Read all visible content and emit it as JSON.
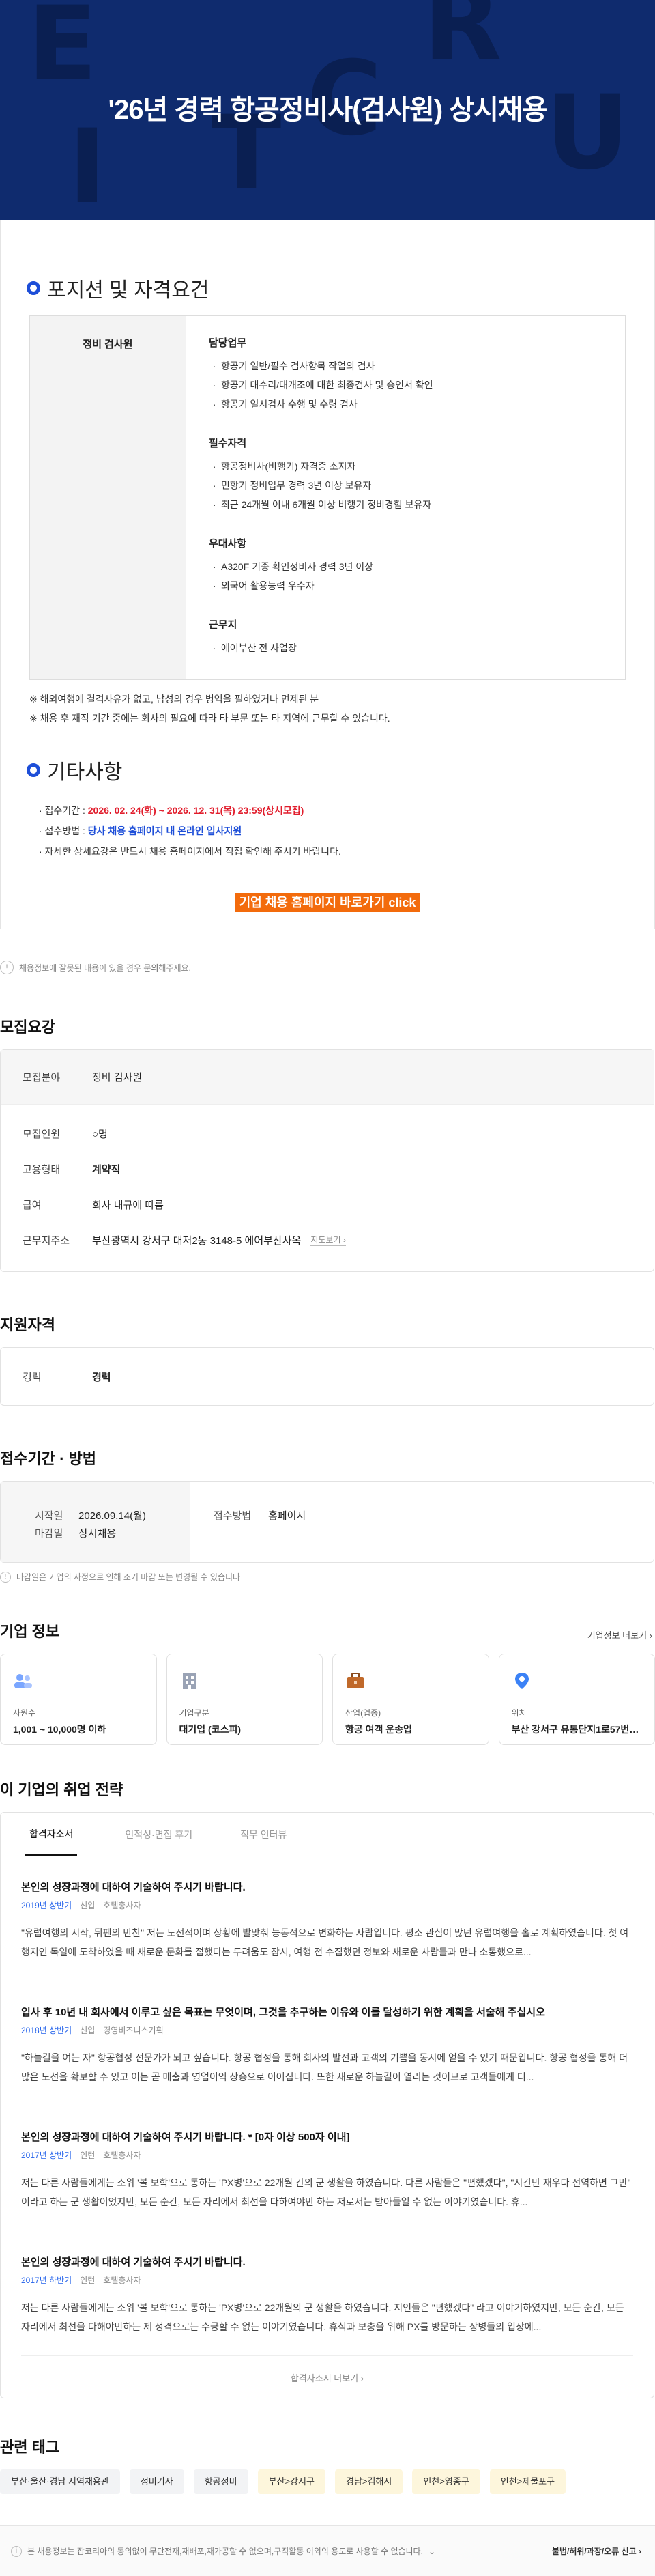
{
  "banner": {
    "title": "'26년 경력 항공정비사(검사원) 상시채용",
    "deco": [
      "E",
      "C",
      "R",
      "U",
      "I",
      "T"
    ]
  },
  "positions": {
    "heading": "포지션 및 자격요건",
    "role": "정비 검사원",
    "groups": [
      {
        "title": "담당업무",
        "items": [
          "항공기 일반/필수 검사항목 작업의 검사",
          "항공기 대수리/대개조에 대한 최종검사 및 승인서 확인",
          "항공기 일시검사 수행 및 수령 검사"
        ]
      },
      {
        "title": "필수자격",
        "items": [
          "항공정비사(비행기) 자격증 소지자",
          "민항기 정비업무 경력 3년 이상 보유자",
          "최근 24개월 이내 6개월 이상 비행기 정비경험 보유자"
        ]
      },
      {
        "title": "우대사항",
        "items": [
          "A320F 기종 확인정비사 경력 3년 이상",
          "외국어 활용능력 우수자"
        ]
      },
      {
        "title": "근무지",
        "items": [
          "에어부산 전 사업장"
        ]
      }
    ],
    "notes": [
      "※ 해외여행에 결격사유가 없고, 남성의 경우 병역을 필하였거나 면제된 분",
      "※ 채용 후 재직 기간 중에는 회사의 필요에 따라 타 부문 또는 타 지역에 근무할 수 있습니다."
    ]
  },
  "misc": {
    "heading": "기타사항",
    "period_label": "· 접수기간 : ",
    "period_value": "2026. 02. 24(화) ~ 2026. 12. 31(목) 23:59(상시모집)",
    "method_label": "· 접수방법 : ",
    "method_value": "당사 채용 홈페이지 내 온라인 입사지원",
    "detail": "· 자세한 상세요강은 반드시 채용 홈페이지에서 직접 확인해 주시기 바랍니다.",
    "button": "기업 채용 홈페이지 바로가기 click"
  },
  "report": {
    "icon": "!",
    "text_before": "채용정보에 잘못된 내용이 있을 경우 ",
    "link": "문의",
    "text_after": "해주세요."
  },
  "requirements": {
    "title": "모집요강",
    "rows": [
      {
        "k": "모집분야",
        "v": "정비 검사원"
      },
      {
        "k": "모집인원",
        "v": "○명"
      },
      {
        "k": "고용형태",
        "v": "계약직"
      },
      {
        "k": "급여",
        "v": "회사 내규에 따름"
      },
      {
        "k": "근무지주소",
        "v": "부산광역시 강서구 대저2동 3148-5 에어부산사옥"
      }
    ],
    "map": "지도보기 ›"
  },
  "qualification": {
    "title": "지원자격",
    "label": "경력",
    "value": "경력"
  },
  "apply": {
    "title": "접수기간 · 방법",
    "start_label": "시작일",
    "start_value": "2026.09.14(월)",
    "end_label": "마감일",
    "end_value": "상시채용",
    "method_label": "접수방법",
    "method_value": "홈페이지",
    "tip": "마감일은 기업의 사정으로 인해 조기 마감 또는 변경될 수 있습니다"
  },
  "company": {
    "title": "기업 정보",
    "more": "기업정보 더보기 ›",
    "cards": [
      {
        "icon": "people-icon",
        "label": "사원수",
        "value": "1,001 ~ 10,000명 이하",
        "color": "#7aa6ff"
      },
      {
        "icon": "building-icon",
        "label": "기업구분",
        "value": "대기업 (코스피)",
        "color": "#9aa3b5"
      },
      {
        "icon": "briefcase-icon",
        "label": "산업(업종)",
        "value": "항공 여객 운송업",
        "color": "#c0692a"
      },
      {
        "icon": "location-icon",
        "label": "위치",
        "value": "부산 강서구 유통단지1로57번가길 12",
        "color": "#3b82f6"
      }
    ]
  },
  "strategy": {
    "title": "이 기업의 취업 전략",
    "tabs": [
      "합격자소서",
      "인적성·면접 후기",
      "직무 인터뷰"
    ],
    "stories": [
      {
        "q": "본인의 성장과정에 대하여 기술하여 주시기 바랍니다.",
        "yr": "2019년 상반기",
        "type": "신입",
        "job": "호텔총사자",
        "a": "\"유럽여행의 시작, 뒤팬의 만찬\" 저는 도전적이며 상황에 발맞춰 능동적으로 변화하는 사람입니다. 평소 관심이 많던 유럽여행을 홀로 계획하였습니다. 첫 여행지인 독일에 도착하였을 때 새로운 문화를 접했다는 두려움도 잠시, 여행 전 수집했던 정보와 새로운 사람들과 만나 소통했으로..."
      },
      {
        "q": "입사 후 10년 내 회사에서 이루고 싶은 목표는 무엇이며, 그것을 추구하는 이유와 이를 달성하기 위한 계획을 서술해 주십시오",
        "yr": "2018년 상반기",
        "type": "신입",
        "job": "경영비즈니스기획",
        "a": "\"하늘길을 여는 자\" 항공협정 전문가가 되고 싶습니다. 항공 협정을 통해 회사의 발전과 고객의 기쁨을 동시에 얻을 수 있기 때문입니다. 항공 협정을 통해 더 많은 노선을 확보할 수 있고 이는 곧 매출과 영업이익 상승으로 이어집니다. 또한 새로운 하늘길이 열리는 것이므로 고객들에게 더..."
      },
      {
        "q": "본인의 성장과정에 대하여 기술하여 주시기 바랍니다. * [0자 이상 500자 이내]",
        "yr": "2017년 상반기",
        "type": "인턴",
        "job": "호텔총사자",
        "a": "저는 다른 사람들에게는 소위 '볼 보학'으로 통하는 'PX병'으로 22개월 간의 군 생활을 하였습니다. 다른 사람들은 \"편했겠다\", \"시간만 재우다 전역하면 그만\" 이라고 하는 군 생활이었지만, 모든 순간, 모든 자리에서 최선을 다하여야만 하는 저로서는 받아들일 수 없는 이야기였습니다. 휴..."
      },
      {
        "q": "본인의 성장과정에 대하여 기술하여 주시기 바랍니다.",
        "yr": "2017년 하반기",
        "type": "인턴",
        "job": "호텔총사자",
        "a": "저는 다른 사람들에게는 소위 '볼 보학'으로 통하는 'PX병'으로 22개월의 군 생활을 하였습니다. 지인들은 \"편했겠다\" 라고 이야기하였지만, 모든 순간, 모든 자리에서 최선을 다해야만하는 제 성격으로는 수긍할 수 없는 이야기였습니다. 휴식과 보충을 위해 PX를 방문하는 장병들의 입장에..."
      }
    ],
    "more": "합격자소서 더보기 ›"
  },
  "tags": {
    "title": "관련 태그",
    "items": [
      "부산·울산·경남 지역채용관",
      "정비기사",
      "항공정비",
      "부산>강서구",
      "경남>김해시",
      "인천>영종구",
      "인천>제물포구"
    ]
  },
  "footer": {
    "notice": "본 채용정보는 잡코리아의 동의없이 무단전재,재배포,재가공할 수 없으며,구직활동 이외의 용도로 사용할 수 없습니다.",
    "report": "불법/허위/과장/오류 신고 ›"
  }
}
